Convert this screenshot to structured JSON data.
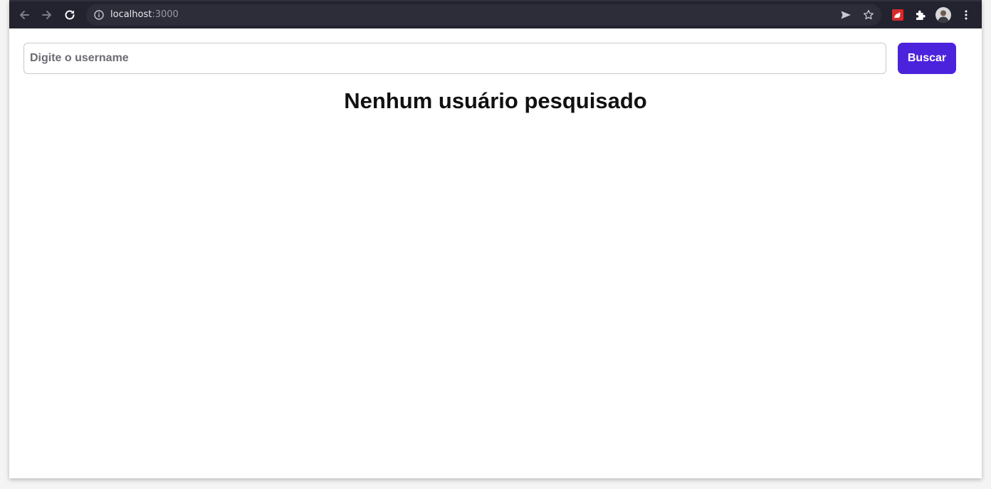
{
  "browser": {
    "url_host": "localhost",
    "url_port": ":3000",
    "colors": {
      "toolbar": "#232330",
      "omnibox": "#2d2d3a"
    },
    "icons": {
      "back": "arrow-left-icon",
      "forward": "arrow-right-icon",
      "reload": "reload-icon",
      "site_info": "info-icon",
      "send": "send-tab-icon",
      "bookmark": "star-icon",
      "extension_app": "red-extension-icon",
      "extensions": "puzzle-icon",
      "profile": "avatar",
      "menu": "kebab-menu-icon"
    }
  },
  "search": {
    "placeholder": "Digite o username",
    "value": "",
    "button_label": "Buscar",
    "button_color": "#4c23dc"
  },
  "main": {
    "empty_message": "Nenhum usuário pesquisado"
  }
}
